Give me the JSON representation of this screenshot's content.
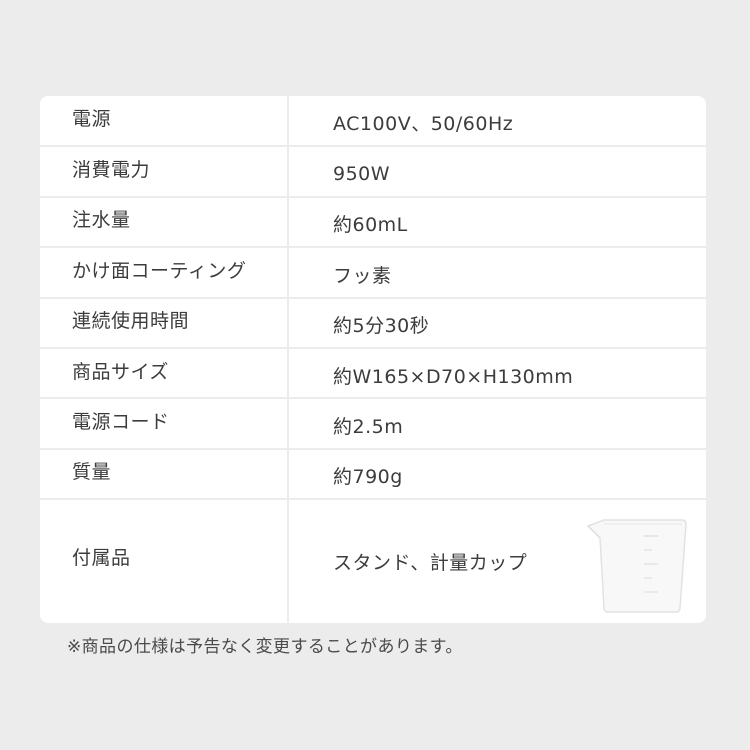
{
  "specs": [
    {
      "label": "電源",
      "value": "AC100V、50/60Hz"
    },
    {
      "label": "消費電力",
      "value": "950W"
    },
    {
      "label": "注水量",
      "value": "約60mL"
    },
    {
      "label": "かけ面コーティング",
      "value": "フッ素"
    },
    {
      "label": "連続使用時間",
      "value": "約5分30秒"
    },
    {
      "label": "商品サイズ",
      "value": "約W165×D70×H130mm"
    },
    {
      "label": "電源コード",
      "value": "約2.5m"
    },
    {
      "label": "質量",
      "value": "約790g"
    },
    {
      "label": "付属品",
      "value": "スタンド、計量カップ"
    }
  ],
  "footnote": "※商品の仕様は予告なく変更することがあります。",
  "colors": {
    "background": "#ececec",
    "card": "#ffffff",
    "divider": "#ececec",
    "text": "#3c3c3c"
  },
  "icons": {
    "accessory_image": "measuring-cup-icon"
  }
}
